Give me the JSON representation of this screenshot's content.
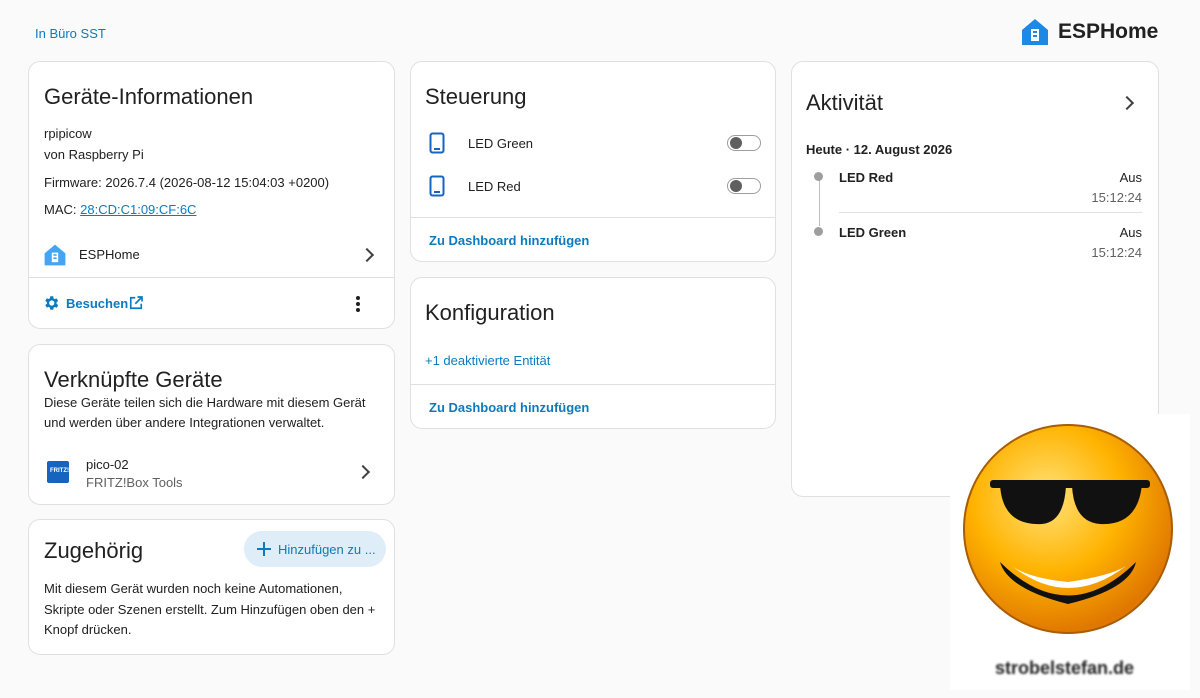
{
  "breadcrumb": "In Büro SST",
  "brand": {
    "name": "ESPHome",
    "color": "#1e88e5"
  },
  "device_info": {
    "title": "Geräte-Informationen",
    "model": "rpipicow",
    "manufacturer": "von Raspberry Pi",
    "firmware": "Firmware: 2026.7.4 (2026-08-12 15:04:03 +0200)",
    "mac_label": "MAC:",
    "mac_value": "28:CD:C1:09:CF:6C",
    "integration": "ESPHome",
    "visit_label": "Besuchen"
  },
  "linked_devices": {
    "title": "Verknüpfte Geräte",
    "description": "Diese Geräte teilen sich die Hardware mit diesem Gerät und werden über andere Integrationen verwaltet.",
    "device_name": "pico-02",
    "device_integration": "FRITZ!Box Tools"
  },
  "related": {
    "title": "Zugehörig",
    "add_button": "Hinzufügen zu ...",
    "text": "Mit diesem Gerät wurden noch keine Automationen, Skripte oder Szenen erstellt. Zum Hinzufügen oben den + Knopf drücken."
  },
  "control": {
    "title": "Steuerung",
    "switches": [
      {
        "label": "LED Green",
        "state": "off"
      },
      {
        "label": "LED Red",
        "state": "off"
      }
    ],
    "dashboard_link": "Zu Dashboard hinzufügen"
  },
  "config": {
    "title": "Konfiguration",
    "disabled_link": "+1 deaktivierte Entität",
    "dashboard_link": "Zu Dashboard hinzufügen"
  },
  "activity": {
    "title": "Aktivität",
    "date": "Heute · 12. August 2026",
    "entries": [
      {
        "name": "LED Red",
        "state": "Aus",
        "time": "15:12:24"
      },
      {
        "name": "LED Green",
        "state": "Aus",
        "time": "15:12:24"
      }
    ]
  },
  "watermark": {
    "text": "strobelstefan.de"
  }
}
